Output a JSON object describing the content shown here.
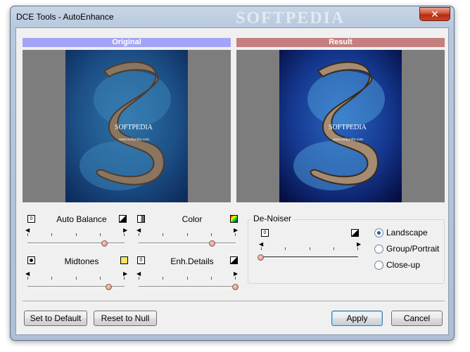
{
  "window": {
    "title": "DCE Tools - AutoEnhance",
    "close_label": "✕",
    "watermark": "SOFTPEDIA"
  },
  "preview": {
    "original_label": "Original",
    "result_label": "Result",
    "image_watermark": "SOFTPEDIA",
    "image_url_text": "www.softpedia.com"
  },
  "sliders": {
    "auto_balance": {
      "label": "Auto Balance",
      "value": 0.8
    },
    "color": {
      "label": "Color",
      "value": 0.76
    },
    "midtones": {
      "label": "Midtones",
      "value": 0.84
    },
    "enh_details": {
      "label": "Enh.Details",
      "value": 1.0
    },
    "denoiser": {
      "value": 0.0
    }
  },
  "denoiser": {
    "title": "De-Noiser",
    "options": [
      "Landscape",
      "Group/Portrait",
      "Close-up"
    ],
    "selected": "Landscape"
  },
  "buttons": {
    "set_default": "Set to Default",
    "reset_null": "Reset to Null",
    "apply": "Apply",
    "cancel": "Cancel"
  },
  "icons": {
    "box_zero": "0",
    "min_icon": "zero-box-icon",
    "max_icon": "contrast-triangle-icon",
    "color_max_icon": "color-gradient-icon",
    "midtones_min_icon": "filled-circle-icon",
    "midtones_max_icon": "sun-icon"
  }
}
